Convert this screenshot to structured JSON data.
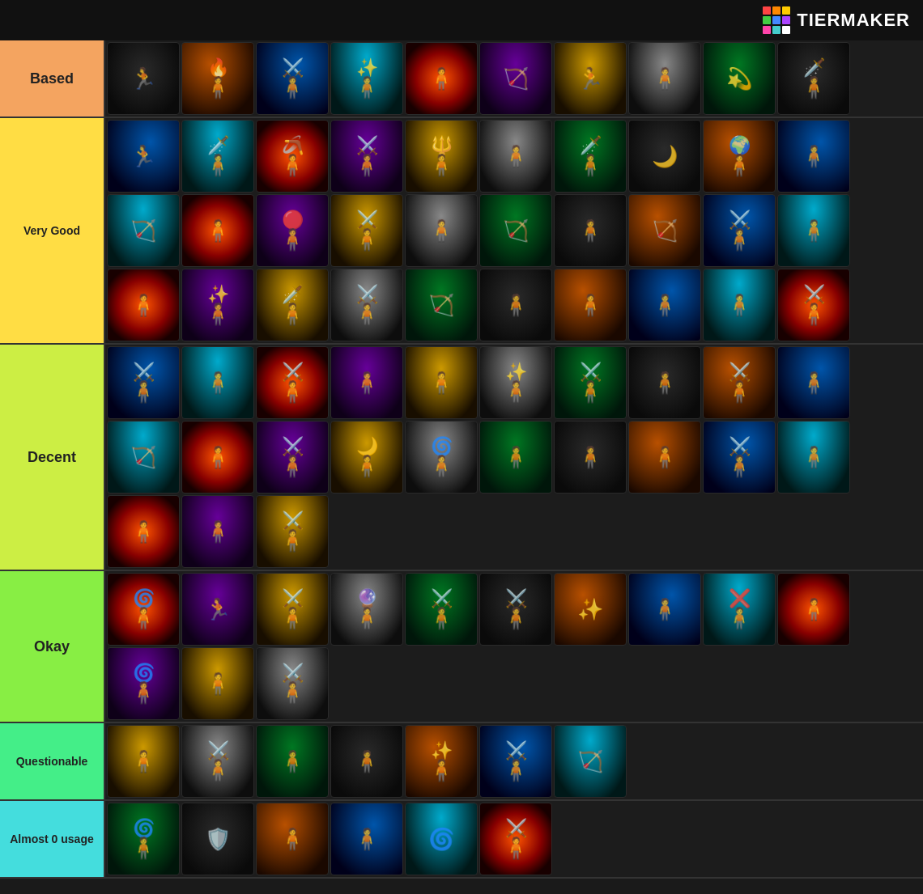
{
  "header": {
    "logo_text": "TiERMAKER",
    "logo_colors": [
      "#ff4444",
      "#ff8800",
      "#ffcc00",
      "#44cc44",
      "#4488ff",
      "#aa44ff",
      "#ff44aa",
      "#44cccc",
      "#ffffff"
    ]
  },
  "tiers": [
    {
      "id": "based",
      "label": "Based",
      "color": "#f4a460",
      "items": [
        {
          "id": "b1",
          "theme": "orange",
          "symbol": "🏃",
          "weapon": ""
        },
        {
          "id": "b2",
          "theme": "fire",
          "symbol": "🧍",
          "weapon": "🔥"
        },
        {
          "id": "b3",
          "theme": "cyan",
          "symbol": "",
          "weapon": "⚔️"
        },
        {
          "id": "b4",
          "theme": "blue",
          "symbol": "🧍",
          "weapon": "✨"
        },
        {
          "id": "b5",
          "theme": "dark",
          "symbol": "🧍",
          "weapon": ""
        },
        {
          "id": "b6",
          "theme": "dark",
          "symbol": "🏹",
          "weapon": ""
        },
        {
          "id": "b7",
          "theme": "fire",
          "symbol": "🏃",
          "weapon": ""
        },
        {
          "id": "b8",
          "theme": "red",
          "symbol": "🧍",
          "weapon": ""
        },
        {
          "id": "b9",
          "theme": "gold",
          "symbol": "💫",
          "weapon": ""
        },
        {
          "id": "b10",
          "theme": "dark",
          "symbol": "🧍",
          "weapon": "🗡️"
        }
      ]
    },
    {
      "id": "verygood",
      "label": "Very Good",
      "color": "#ffdd44",
      "items": [
        {
          "id": "vg1",
          "theme": "white",
          "symbol": "🏃",
          "weapon": ""
        },
        {
          "id": "vg2",
          "theme": "dark",
          "symbol": "🧍",
          "weapon": "🗡️"
        },
        {
          "id": "vg3",
          "theme": "fire",
          "symbol": "",
          "weapon": "🪃"
        },
        {
          "id": "vg4",
          "theme": "dark",
          "symbol": "🧍",
          "weapon": "⚔️"
        },
        {
          "id": "vg5",
          "theme": "dark",
          "symbol": "🧍",
          "weapon": "🔱"
        },
        {
          "id": "vg6",
          "theme": "dark",
          "symbol": "🧍",
          "weapon": ""
        },
        {
          "id": "vg7",
          "theme": "white",
          "symbol": "",
          "weapon": "🗡️"
        },
        {
          "id": "vg8",
          "theme": "gold",
          "symbol": "🌙",
          "weapon": ""
        },
        {
          "id": "vg9",
          "theme": "silver",
          "symbol": "",
          "weapon": "🌍"
        },
        {
          "id": "vg10",
          "theme": "blue",
          "symbol": "🧍",
          "weapon": ""
        },
        {
          "id": "vg11",
          "theme": "dark",
          "symbol": "🏹",
          "weapon": ""
        },
        {
          "id": "vg12",
          "theme": "dark",
          "symbol": "🧍",
          "weapon": ""
        },
        {
          "id": "vg13",
          "theme": "red",
          "symbol": "",
          "weapon": "🔴"
        },
        {
          "id": "vg14",
          "theme": "dark",
          "symbol": "🧍",
          "weapon": "⚔️"
        },
        {
          "id": "vg15",
          "theme": "dark",
          "symbol": "🧍",
          "weapon": ""
        },
        {
          "id": "vg16",
          "theme": "dark",
          "symbol": "🏹",
          "weapon": ""
        },
        {
          "id": "vg17",
          "theme": "green",
          "symbol": "",
          "weapon": ""
        },
        {
          "id": "vg18",
          "theme": "dark",
          "symbol": "🏹",
          "weapon": ""
        },
        {
          "id": "vg19",
          "theme": "dark",
          "symbol": "",
          "weapon": "⚔️"
        },
        {
          "id": "vg20",
          "theme": "dark",
          "symbol": "🧍",
          "weapon": ""
        },
        {
          "id": "vg21",
          "theme": "dark",
          "symbol": "🧍",
          "weapon": ""
        },
        {
          "id": "vg22",
          "theme": "gold",
          "symbol": "🧍",
          "weapon": "✨"
        },
        {
          "id": "vg23",
          "theme": "gold",
          "symbol": "",
          "weapon": "🗡️"
        },
        {
          "id": "vg24",
          "theme": "dark",
          "symbol": "🧍",
          "weapon": "⚔️"
        },
        {
          "id": "vg25",
          "theme": "dark",
          "symbol": "🏹",
          "weapon": ""
        },
        {
          "id": "vg26",
          "theme": "dark",
          "symbol": "🧍",
          "weapon": ""
        },
        {
          "id": "vg27",
          "theme": "fire",
          "symbol": "🧍",
          "weapon": ""
        },
        {
          "id": "vg28",
          "theme": "dark",
          "symbol": "🧍",
          "weapon": ""
        },
        {
          "id": "vg29",
          "theme": "dark",
          "symbol": "🧍",
          "weapon": ""
        },
        {
          "id": "vg30",
          "theme": "purple",
          "symbol": "",
          "weapon": "⚔️"
        }
      ]
    },
    {
      "id": "decent",
      "label": "Decent",
      "color": "#ccee44",
      "items": [
        {
          "id": "d1",
          "theme": "purple",
          "symbol": "",
          "weapon": "⚔️"
        },
        {
          "id": "d2",
          "theme": "fire",
          "symbol": "🧍",
          "weapon": ""
        },
        {
          "id": "d3",
          "theme": "purple",
          "symbol": "",
          "weapon": "⚔️"
        },
        {
          "id": "d4",
          "theme": "dark",
          "symbol": "🧍",
          "weapon": ""
        },
        {
          "id": "d5",
          "theme": "dark",
          "symbol": "🧍",
          "weapon": ""
        },
        {
          "id": "d6",
          "theme": "dark",
          "symbol": "🧍",
          "weapon": "✨"
        },
        {
          "id": "d7",
          "theme": "purple",
          "symbol": "",
          "weapon": "⚔️"
        },
        {
          "id": "d8",
          "theme": "gold",
          "symbol": "",
          "weapon": ""
        },
        {
          "id": "d9",
          "theme": "dark",
          "symbol": "",
          "weapon": "⚔️"
        },
        {
          "id": "d10",
          "theme": "dark",
          "symbol": "🧍",
          "weapon": ""
        },
        {
          "id": "d11",
          "theme": "dark",
          "symbol": "🏹",
          "weapon": ""
        },
        {
          "id": "d12",
          "theme": "gold",
          "symbol": "🧍",
          "weapon": ""
        },
        {
          "id": "d13",
          "theme": "dark",
          "symbol": "",
          "weapon": "⚔️"
        },
        {
          "id": "d14",
          "theme": "gold",
          "symbol": "",
          "weapon": "🌙"
        },
        {
          "id": "d15",
          "theme": "dark",
          "symbol": "",
          "weapon": "🌀"
        },
        {
          "id": "d16",
          "theme": "dark",
          "symbol": "🧍",
          "weapon": ""
        },
        {
          "id": "d17",
          "theme": "red",
          "symbol": "",
          "weapon": ""
        },
        {
          "id": "d18",
          "theme": "white",
          "symbol": "🧍",
          "weapon": ""
        },
        {
          "id": "d19",
          "theme": "dark",
          "symbol": "🧍",
          "weapon": "⚔️"
        },
        {
          "id": "d20",
          "theme": "dark",
          "symbol": "🧍",
          "weapon": ""
        },
        {
          "id": "d21",
          "theme": "gold",
          "symbol": "🧍",
          "weapon": ""
        },
        {
          "id": "d22",
          "theme": "dark",
          "symbol": "🧍",
          "weapon": ""
        },
        {
          "id": "d23",
          "theme": "dark",
          "symbol": "",
          "weapon": "⚔️"
        }
      ]
    },
    {
      "id": "okay",
      "label": "Okay",
      "color": "#88ee44",
      "items": [
        {
          "id": "o1",
          "theme": "dark",
          "symbol": "",
          "weapon": "🌀"
        },
        {
          "id": "o2",
          "theme": "dark",
          "symbol": "🏃",
          "weapon": ""
        },
        {
          "id": "o3",
          "theme": "blue",
          "symbol": "",
          "weapon": "⚔️"
        },
        {
          "id": "o4",
          "theme": "gold",
          "symbol": "",
          "weapon": "🔮"
        },
        {
          "id": "o5",
          "theme": "dark",
          "symbol": "🧍",
          "weapon": "⚔️"
        },
        {
          "id": "o6",
          "theme": "cyan",
          "symbol": "",
          "weapon": "⚔️"
        },
        {
          "id": "o7",
          "theme": "cyan",
          "symbol": "✨",
          "weapon": ""
        },
        {
          "id": "o8",
          "theme": "dark",
          "symbol": "🧍",
          "weapon": ""
        },
        {
          "id": "o9",
          "theme": "dark",
          "symbol": "",
          "weapon": "❌"
        },
        {
          "id": "o10",
          "theme": "dark",
          "symbol": "🧍",
          "weapon": ""
        },
        {
          "id": "o11",
          "theme": "cyan",
          "symbol": "",
          "weapon": "🌀"
        },
        {
          "id": "o12",
          "theme": "dark",
          "symbol": "🧍",
          "weapon": ""
        },
        {
          "id": "o13",
          "theme": "dark",
          "symbol": "",
          "weapon": "⚔️"
        }
      ]
    },
    {
      "id": "questionable",
      "label": "Questionable",
      "color": "#44ee88",
      "items": [
        {
          "id": "q1",
          "theme": "dark",
          "symbol": "🧍",
          "weapon": ""
        },
        {
          "id": "q2",
          "theme": "dark",
          "symbol": "",
          "weapon": "⚔️"
        },
        {
          "id": "q3",
          "theme": "dark",
          "symbol": "🧍",
          "weapon": ""
        },
        {
          "id": "q4",
          "theme": "dark",
          "symbol": "🧍",
          "weapon": ""
        },
        {
          "id": "q5",
          "theme": "gold",
          "symbol": "🧍",
          "weapon": "✨"
        },
        {
          "id": "q6",
          "theme": "dark",
          "symbol": "",
          "weapon": "⚔️"
        },
        {
          "id": "q7",
          "theme": "dark",
          "symbol": "🏹",
          "weapon": ""
        }
      ]
    },
    {
      "id": "almost0",
      "label": "Almost 0 usage",
      "color": "#44dddd",
      "items": [
        {
          "id": "a1",
          "theme": "dark",
          "symbol": "",
          "weapon": "🌀"
        },
        {
          "id": "a2",
          "theme": "dark",
          "symbol": "🛡️",
          "weapon": ""
        },
        {
          "id": "a3",
          "theme": "dark",
          "symbol": "🧍",
          "weapon": ""
        },
        {
          "id": "a4",
          "theme": "dark",
          "symbol": "🧍",
          "weapon": ""
        },
        {
          "id": "a5",
          "theme": "red",
          "symbol": "🌀",
          "weapon": ""
        },
        {
          "id": "a6",
          "theme": "dark",
          "symbol": "",
          "weapon": "⚔️"
        }
      ]
    }
  ]
}
